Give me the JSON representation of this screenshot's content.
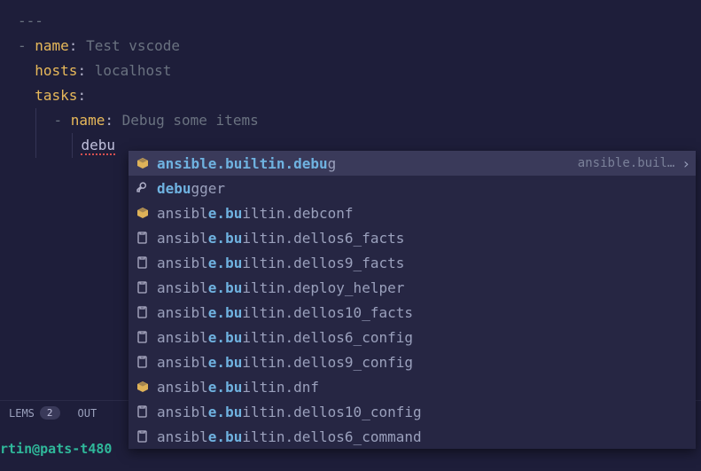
{
  "editor": {
    "line1": "---",
    "playName_key": "name",
    "playName_val": "Test vscode",
    "hosts_key": "hosts",
    "hosts_val": "localhost",
    "tasks_key": "tasks",
    "taskName_key": "name",
    "taskName_val": "Debug some items",
    "typed": "debu"
  },
  "suggestions": [
    {
      "icon": "module",
      "parts": [
        "",
        "ansible.builtin.",
        "debu",
        "g"
      ],
      "detail": "ansible.buil…",
      "selected": true,
      "chevron": true
    },
    {
      "icon": "property",
      "parts": [
        "",
        "",
        "debu",
        "gger"
      ],
      "detail": "",
      "selected": false
    },
    {
      "icon": "module",
      "parts": [
        "ansibl",
        "e.bu",
        "",
        "iltin.debconf"
      ],
      "detail": "",
      "selected": false
    },
    {
      "icon": "snippet",
      "parts": [
        "ansibl",
        "e.bu",
        "",
        "iltin.dellos6_facts"
      ],
      "detail": "",
      "selected": false
    },
    {
      "icon": "snippet",
      "parts": [
        "ansibl",
        "e.bu",
        "",
        "iltin.dellos9_facts"
      ],
      "detail": "",
      "selected": false
    },
    {
      "icon": "snippet",
      "parts": [
        "ansibl",
        "e.bu",
        "",
        "iltin.deploy_helper"
      ],
      "detail": "",
      "selected": false
    },
    {
      "icon": "snippet",
      "parts": [
        "ansibl",
        "e.bu",
        "",
        "iltin.dellos10_facts"
      ],
      "detail": "",
      "selected": false
    },
    {
      "icon": "snippet",
      "parts": [
        "ansibl",
        "e.bu",
        "",
        "iltin.dellos6_config"
      ],
      "detail": "",
      "selected": false
    },
    {
      "icon": "snippet",
      "parts": [
        "ansibl",
        "e.bu",
        "",
        "iltin.dellos9_config"
      ],
      "detail": "",
      "selected": false
    },
    {
      "icon": "module",
      "parts": [
        "ansibl",
        "e.bu",
        "",
        "iltin.dnf"
      ],
      "detail": "",
      "selected": false
    },
    {
      "icon": "snippet",
      "parts": [
        "ansibl",
        "e.bu",
        "",
        "iltin.dellos10_config"
      ],
      "detail": "",
      "selected": false
    },
    {
      "icon": "snippet",
      "parts": [
        "ansibl",
        "e.bu",
        "",
        "iltin.dellos6_command"
      ],
      "detail": "",
      "selected": false
    }
  ],
  "panel": {
    "tab1": "LEMS",
    "tab1_badge": "2",
    "tab2": "OUT"
  },
  "terminal": {
    "prompt": "rtin@pats-t480"
  },
  "icons": {
    "module_color": "#e8b95a",
    "property_color": "#b0b0c8",
    "snippet_color": "#b0b0c8"
  }
}
